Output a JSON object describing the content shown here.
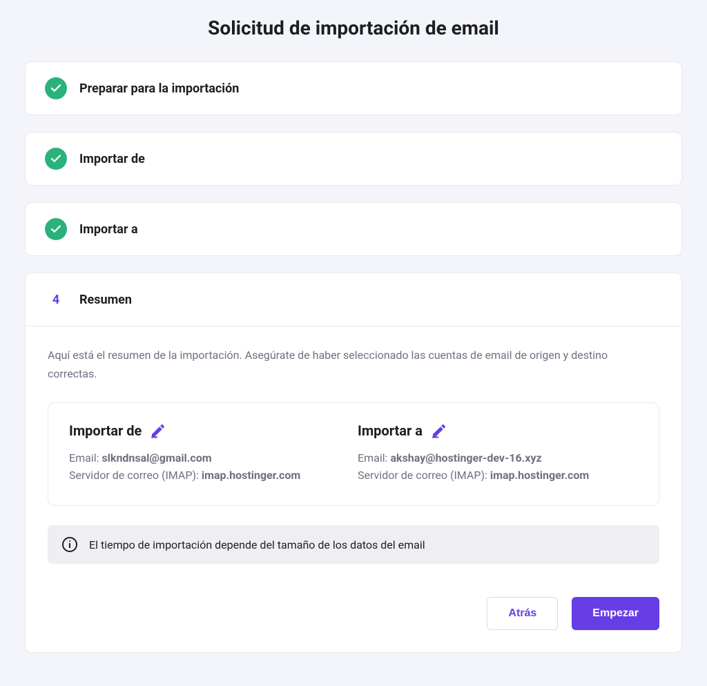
{
  "title": "Solicitud de importación de email",
  "steps": [
    {
      "label": "Preparar para la importación"
    },
    {
      "label": "Importar de"
    },
    {
      "label": "Importar a"
    }
  ],
  "current": {
    "number": "4",
    "label": "Resumen",
    "description": "Aquí está el resumen de la importación. Asegúrate de haber seleccionado las cuentas de email de origen y destino correctas."
  },
  "summary": {
    "from": {
      "title": "Importar de",
      "email_label": "Email: ",
      "email_value": "slkndnsal@gmail.com",
      "server_label": "Servidor de correo (IMAP): ",
      "server_value": "imap.hostinger.com"
    },
    "to": {
      "title": "Importar a",
      "email_label": "Email: ",
      "email_value": "akshay@hostinger-dev-16.xyz",
      "server_label": "Servidor de correo (IMAP): ",
      "server_value": "imap.hostinger.com"
    }
  },
  "info_text": "El tiempo de importación depende del tamaño de los datos del email",
  "buttons": {
    "back": "Atrás",
    "start": "Empezar"
  }
}
